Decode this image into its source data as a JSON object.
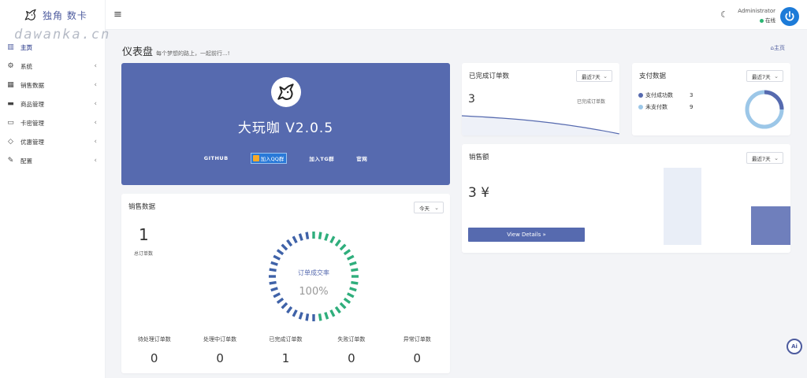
{
  "brand": {
    "title": "独角 数卡",
    "watermark": "dawanka.cn"
  },
  "sidebar": {
    "items": [
      {
        "label": "主页",
        "icon": "bar-chart-icon",
        "active": true
      },
      {
        "label": "系统",
        "icon": "gear-icon"
      },
      {
        "label": "销售数据",
        "icon": "table-icon"
      },
      {
        "label": "商品管理",
        "icon": "briefcase-icon"
      },
      {
        "label": "卡密管理",
        "icon": "credit-card-icon"
      },
      {
        "label": "优惠管理",
        "icon": "diamond-icon"
      },
      {
        "label": "配置",
        "icon": "wrench-icon"
      }
    ],
    "chevron": "‹"
  },
  "topbar": {
    "menu_icon": "≡",
    "user_name": "Administrator",
    "user_status": "在线"
  },
  "header": {
    "title": "仪表盘",
    "subtitle": "每个梦想的路上，一起前行...!",
    "crumb": "主页"
  },
  "hero": {
    "title": "大玩咖 V2.0.5",
    "links": {
      "github": "GITHUB",
      "qq": "加入QQ群",
      "tg": "加入TG群",
      "site": "官网"
    }
  },
  "sales_card": {
    "title": "销售数据",
    "filter": "今天",
    "total_orders": "1",
    "total_orders_label": "总订单数",
    "gauge_label": "订单成交率",
    "gauge_value": "100%",
    "bottom": [
      {
        "label": "待处理订单数",
        "value": "0"
      },
      {
        "label": "处理中订单数",
        "value": "0"
      },
      {
        "label": "已完成订单数",
        "value": "1"
      },
      {
        "label": "失败订单数",
        "value": "0"
      },
      {
        "label": "异常订单数",
        "value": "0"
      }
    ]
  },
  "completed_card": {
    "title": "已完成订单数",
    "filter": "最近7天",
    "value": "3",
    "label": "已完成订单数"
  },
  "payment_card": {
    "title": "支付数据",
    "filter": "最近7天",
    "legend": [
      {
        "label": "支付成功数",
        "value": "3",
        "color": "#566aaf"
      },
      {
        "label": "未支付数",
        "value": "9",
        "color": "#9cc7e8"
      }
    ]
  },
  "revenue_card": {
    "title": "销售额",
    "filter": "最近7天",
    "value": "3 ¥",
    "button": "View Details »"
  },
  "ai_button": "Ai",
  "colors": {
    "accent": "#566aaf",
    "success": "#2bb673",
    "light_blue": "#9cc7e8"
  }
}
